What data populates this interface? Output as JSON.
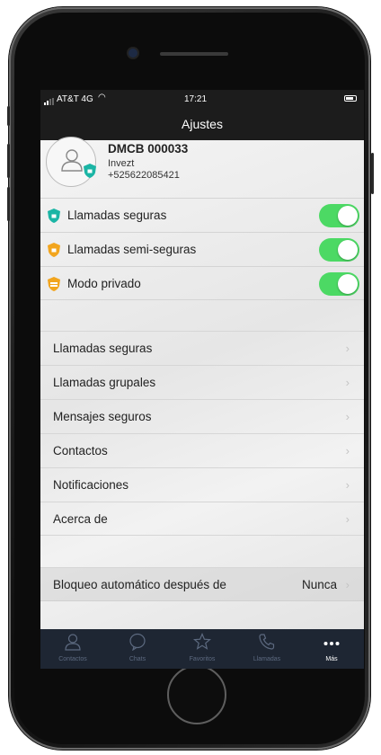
{
  "status_bar": {
    "carrier": "AT&T 4G",
    "time": "17:21"
  },
  "nav": {
    "title": "Ajustes"
  },
  "profile": {
    "name": "DMCB 000033",
    "org": "Invezt",
    "phone": "+525622085421"
  },
  "toggles": [
    {
      "label": "Llamadas seguras",
      "shield_color": "#1bb5a5",
      "on": true
    },
    {
      "label": "Llamadas semi-seguras",
      "shield_color": "#f2a51e",
      "on": true
    },
    {
      "label": "Modo  privado",
      "shield_color": "#f2a51e",
      "on": true
    }
  ],
  "menu": [
    {
      "label": "Llamadas seguras"
    },
    {
      "label": "Llamadas grupales"
    },
    {
      "label": "Mensajes seguros"
    },
    {
      "label": "Contactos"
    },
    {
      "label": "Notificaciones"
    },
    {
      "label": "Acerca de"
    }
  ],
  "auto_lock": {
    "label": "Bloqueo automático después de",
    "value": "Nunca"
  },
  "tabs": [
    {
      "label": "Contactos",
      "icon": "contacts-icon"
    },
    {
      "label": "Chats",
      "icon": "chat-bubble-icon"
    },
    {
      "label": "Favoritos",
      "icon": "star-icon"
    },
    {
      "label": "Llamadas",
      "icon": "phone-icon"
    },
    {
      "label": "Más",
      "icon": "more-icon",
      "active": true
    }
  ],
  "colors": {
    "toggle_on": "#4cd964",
    "tab_bar": "#1e2633",
    "nav_bar": "#1c1c1c"
  }
}
